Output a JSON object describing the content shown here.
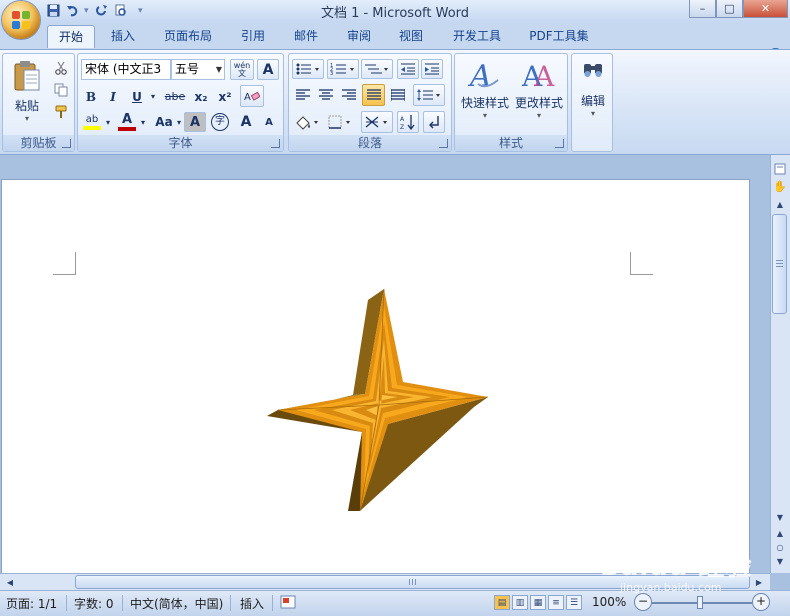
{
  "window": {
    "title": "文档 1 - Microsoft Word",
    "minimize": "–",
    "maximize": "□",
    "close": "✕"
  },
  "quick_access": {
    "save_icon": "save-icon",
    "undo_icon": "undo-icon",
    "redo_icon": "redo-icon",
    "print_preview_icon": "print-preview-icon",
    "customize_icon": "customize-qat-icon"
  },
  "tabs": [
    "开始",
    "插入",
    "页面布局",
    "引用",
    "邮件",
    "审阅",
    "视图",
    "开发工具",
    "PDF工具集"
  ],
  "help_label": "?",
  "ribbon": {
    "clipboard": {
      "label": "剪贴板",
      "paste": "粘贴"
    },
    "font": {
      "label": "字体",
      "font_name": "宋体 (中文正3",
      "font_size": "五号",
      "phonetic": "wén\n文",
      "char_border": "A",
      "bold": "B",
      "italic": "I",
      "underline": "U",
      "strike": "abe",
      "subscript": "x₂",
      "superscript": "x²",
      "highlight": "ab",
      "font_color": "A",
      "change_case": "Aa",
      "char_shading": "A",
      "enclose": "字",
      "grow": "A",
      "shrink": "A"
    },
    "paragraph": {
      "label": "段落"
    },
    "styles": {
      "label": "样式",
      "quick_styles": "快速样式",
      "change_styles": "更改样式"
    },
    "editing": {
      "label": "编辑"
    }
  },
  "status": {
    "page": "页面: 1/1",
    "words": "字数: 0",
    "language": "中文(简体，中国)",
    "mode": "插入",
    "zoom": "100%",
    "zoom_minus": "−",
    "zoom_plus": "+"
  },
  "watermark": {
    "brand": "Baidu 经验",
    "url": "jingyan.baidu.com"
  },
  "colors": {
    "star_light": "#f7a81c",
    "star_dark": "#6b4a0e",
    "star_mid": "#a77a1c"
  }
}
